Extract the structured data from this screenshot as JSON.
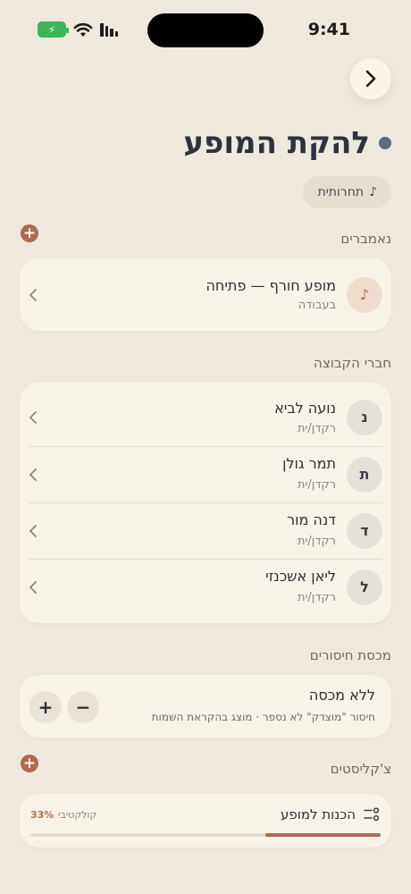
{
  "status_bar": {
    "time": "9:41"
  },
  "header": {
    "title": "להקת המופע",
    "tag_label": "תחרותית"
  },
  "sections": {
    "numbers": {
      "label": "נאמברים",
      "items": [
        {
          "name": "מופע חורף — פתיחה",
          "status": "בעבודה"
        }
      ]
    },
    "members": {
      "label": "חברי הקבוצה",
      "items": [
        {
          "initial": "נ",
          "name": "נועה לביא",
          "role": "רקדן/ית"
        },
        {
          "initial": "ת",
          "name": "תמר גולן",
          "role": "רקדן/ית"
        },
        {
          "initial": "ד",
          "name": "דנה מור",
          "role": "רקדן/ית"
        },
        {
          "initial": "ל",
          "name": "ליאן אשכנזי",
          "role": "רקדן/ית"
        }
      ]
    },
    "absence_quota": {
      "label": "מכסת חיסורים",
      "value": "ללא מכסה",
      "description": "חיסור \"מוצדק\" לא נספר · מוצג בהקראת השמות",
      "plus": "+",
      "minus": "−"
    },
    "checklists": {
      "label": "צ'קליסטים",
      "items": [
        {
          "name": "הכנות למופע",
          "scope": "קולקטיבי",
          "percent_label": "33%",
          "progress": 0.33
        }
      ]
    }
  },
  "colors": {
    "accent": "#b06a4e",
    "background": "#efe8dd",
    "card": "#f8f3e9"
  }
}
